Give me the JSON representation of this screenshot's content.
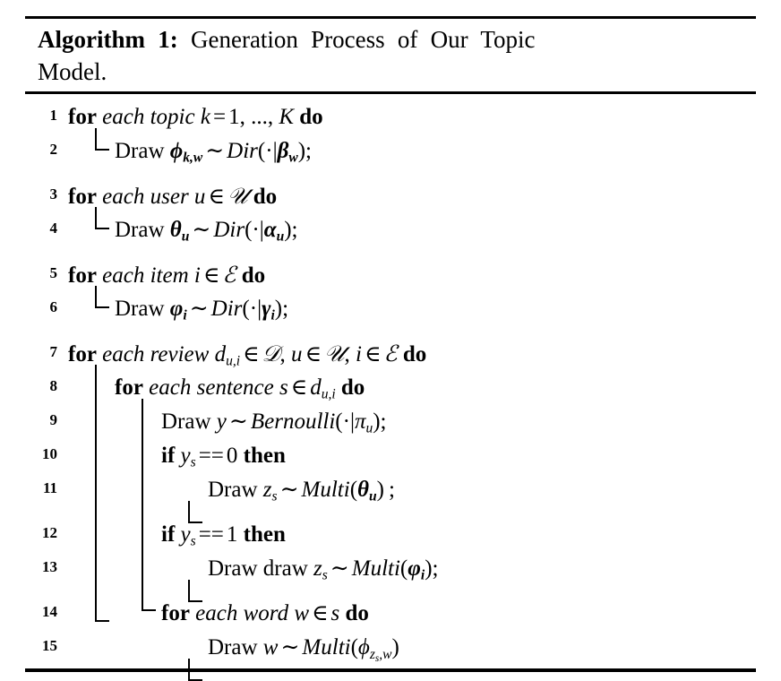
{
  "algorithm": {
    "label": "Algorithm 1:",
    "title": "Generation Process of Our Topic Model.",
    "title_line1": "Generation Process of Our Topic",
    "title_line2": "Model.",
    "line_numbers": [
      "1",
      "2",
      "3",
      "4",
      "5",
      "6",
      "7",
      "8",
      "9",
      "10",
      "11",
      "12",
      "13",
      "14",
      "15"
    ],
    "lines": [
      {
        "num": "1",
        "indent": 0,
        "text": "for each topic k = 1, ..., K do"
      },
      {
        "num": "2",
        "indent": 1,
        "text": "Draw ϕk,w ~ Dir(·|βw);"
      },
      {
        "num": "3",
        "indent": 0,
        "text": "for each user u ∈ 𝒰 do"
      },
      {
        "num": "4",
        "indent": 1,
        "text": "Draw θu ~ Dir(·|αu);"
      },
      {
        "num": "5",
        "indent": 0,
        "text": "for each item i ∈ 𝐼 do"
      },
      {
        "num": "6",
        "indent": 1,
        "text": "Draw φi ~ Dir(·|γi);"
      },
      {
        "num": "7",
        "indent": 0,
        "text": "for each review du,i ∈ 𝐷, u ∈ 𝒰, i ∈ 𝐼 do"
      },
      {
        "num": "8",
        "indent": 1,
        "text": "for each sentence s ∈ du,i do"
      },
      {
        "num": "9",
        "indent": 2,
        "text": "Draw y ~ Bernoulli(·|πu);"
      },
      {
        "num": "10",
        "indent": 2,
        "text": "if ys == 0 then"
      },
      {
        "num": "11",
        "indent": 3,
        "text": "Draw zs ~ Multi(θu) ;"
      },
      {
        "num": "12",
        "indent": 2,
        "text": "if ys == 1 then"
      },
      {
        "num": "13",
        "indent": 3,
        "text": "Draw draw zs ~ Multi(φi);"
      },
      {
        "num": "14",
        "indent": 2,
        "text": "for each word w ∈ s do"
      },
      {
        "num": "15",
        "indent": 3,
        "text": "Draw w ~ Multi(ϕzs,w)"
      }
    ],
    "keywords": {
      "for": "for",
      "do": "do",
      "if": "if",
      "then": "then",
      "draw": "Draw"
    },
    "symbols": {
      "distributed_as": "∼",
      "element_of": "∈",
      "dot": "·",
      "mid": "|",
      "dirichlet": "Dir",
      "multinomial": "Multi",
      "bernoulli": "Bernoulli",
      "set_users": "𝒰",
      "set_items": "ℐ",
      "set_reviews": "𝒟"
    },
    "colors": {
      "ink": "#000000",
      "background": "#ffffff"
    }
  }
}
